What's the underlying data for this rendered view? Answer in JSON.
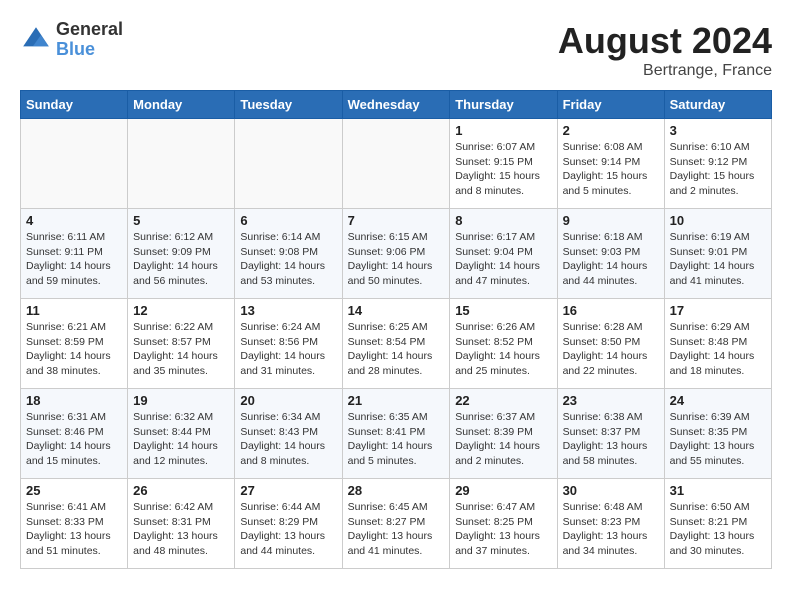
{
  "header": {
    "logo_general": "General",
    "logo_blue": "Blue",
    "month_year": "August 2024",
    "location": "Bertrange, France"
  },
  "weekdays": [
    "Sunday",
    "Monday",
    "Tuesday",
    "Wednesday",
    "Thursday",
    "Friday",
    "Saturday"
  ],
  "weeks": [
    [
      {
        "day": "",
        "info": ""
      },
      {
        "day": "",
        "info": ""
      },
      {
        "day": "",
        "info": ""
      },
      {
        "day": "",
        "info": ""
      },
      {
        "day": "1",
        "info": "Sunrise: 6:07 AM\nSunset: 9:15 PM\nDaylight: 15 hours\nand 8 minutes."
      },
      {
        "day": "2",
        "info": "Sunrise: 6:08 AM\nSunset: 9:14 PM\nDaylight: 15 hours\nand 5 minutes."
      },
      {
        "day": "3",
        "info": "Sunrise: 6:10 AM\nSunset: 9:12 PM\nDaylight: 15 hours\nand 2 minutes."
      }
    ],
    [
      {
        "day": "4",
        "info": "Sunrise: 6:11 AM\nSunset: 9:11 PM\nDaylight: 14 hours\nand 59 minutes."
      },
      {
        "day": "5",
        "info": "Sunrise: 6:12 AM\nSunset: 9:09 PM\nDaylight: 14 hours\nand 56 minutes."
      },
      {
        "day": "6",
        "info": "Sunrise: 6:14 AM\nSunset: 9:08 PM\nDaylight: 14 hours\nand 53 minutes."
      },
      {
        "day": "7",
        "info": "Sunrise: 6:15 AM\nSunset: 9:06 PM\nDaylight: 14 hours\nand 50 minutes."
      },
      {
        "day": "8",
        "info": "Sunrise: 6:17 AM\nSunset: 9:04 PM\nDaylight: 14 hours\nand 47 minutes."
      },
      {
        "day": "9",
        "info": "Sunrise: 6:18 AM\nSunset: 9:03 PM\nDaylight: 14 hours\nand 44 minutes."
      },
      {
        "day": "10",
        "info": "Sunrise: 6:19 AM\nSunset: 9:01 PM\nDaylight: 14 hours\nand 41 minutes."
      }
    ],
    [
      {
        "day": "11",
        "info": "Sunrise: 6:21 AM\nSunset: 8:59 PM\nDaylight: 14 hours\nand 38 minutes."
      },
      {
        "day": "12",
        "info": "Sunrise: 6:22 AM\nSunset: 8:57 PM\nDaylight: 14 hours\nand 35 minutes."
      },
      {
        "day": "13",
        "info": "Sunrise: 6:24 AM\nSunset: 8:56 PM\nDaylight: 14 hours\nand 31 minutes."
      },
      {
        "day": "14",
        "info": "Sunrise: 6:25 AM\nSunset: 8:54 PM\nDaylight: 14 hours\nand 28 minutes."
      },
      {
        "day": "15",
        "info": "Sunrise: 6:26 AM\nSunset: 8:52 PM\nDaylight: 14 hours\nand 25 minutes."
      },
      {
        "day": "16",
        "info": "Sunrise: 6:28 AM\nSunset: 8:50 PM\nDaylight: 14 hours\nand 22 minutes."
      },
      {
        "day": "17",
        "info": "Sunrise: 6:29 AM\nSunset: 8:48 PM\nDaylight: 14 hours\nand 18 minutes."
      }
    ],
    [
      {
        "day": "18",
        "info": "Sunrise: 6:31 AM\nSunset: 8:46 PM\nDaylight: 14 hours\nand 15 minutes."
      },
      {
        "day": "19",
        "info": "Sunrise: 6:32 AM\nSunset: 8:44 PM\nDaylight: 14 hours\nand 12 minutes."
      },
      {
        "day": "20",
        "info": "Sunrise: 6:34 AM\nSunset: 8:43 PM\nDaylight: 14 hours\nand 8 minutes."
      },
      {
        "day": "21",
        "info": "Sunrise: 6:35 AM\nSunset: 8:41 PM\nDaylight: 14 hours\nand 5 minutes."
      },
      {
        "day": "22",
        "info": "Sunrise: 6:37 AM\nSunset: 8:39 PM\nDaylight: 14 hours\nand 2 minutes."
      },
      {
        "day": "23",
        "info": "Sunrise: 6:38 AM\nSunset: 8:37 PM\nDaylight: 13 hours\nand 58 minutes."
      },
      {
        "day": "24",
        "info": "Sunrise: 6:39 AM\nSunset: 8:35 PM\nDaylight: 13 hours\nand 55 minutes."
      }
    ],
    [
      {
        "day": "25",
        "info": "Sunrise: 6:41 AM\nSunset: 8:33 PM\nDaylight: 13 hours\nand 51 minutes."
      },
      {
        "day": "26",
        "info": "Sunrise: 6:42 AM\nSunset: 8:31 PM\nDaylight: 13 hours\nand 48 minutes."
      },
      {
        "day": "27",
        "info": "Sunrise: 6:44 AM\nSunset: 8:29 PM\nDaylight: 13 hours\nand 44 minutes."
      },
      {
        "day": "28",
        "info": "Sunrise: 6:45 AM\nSunset: 8:27 PM\nDaylight: 13 hours\nand 41 minutes."
      },
      {
        "day": "29",
        "info": "Sunrise: 6:47 AM\nSunset: 8:25 PM\nDaylight: 13 hours\nand 37 minutes."
      },
      {
        "day": "30",
        "info": "Sunrise: 6:48 AM\nSunset: 8:23 PM\nDaylight: 13 hours\nand 34 minutes."
      },
      {
        "day": "31",
        "info": "Sunrise: 6:50 AM\nSunset: 8:21 PM\nDaylight: 13 hours\nand 30 minutes."
      }
    ]
  ]
}
